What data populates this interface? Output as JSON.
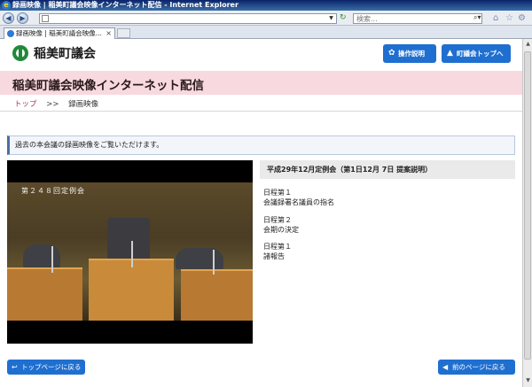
{
  "browser": {
    "window_title": "録画映像 | 稲美町議会映像インターネット配信 - Internet Explorer",
    "search_placeholder": "検索...",
    "tab_title": "録画映像 | 稲美町議会映像..."
  },
  "header": {
    "site_name": "稲美町議会",
    "guide_button": "操作説明",
    "council_top_button": "町議会トップへ"
  },
  "banner": {
    "title": "稲美町議会映像インターネット配信"
  },
  "breadcrumb": {
    "home": "トップ",
    "separator": ">>",
    "current": "録画映像"
  },
  "notice": "過去の本会議の録画映像をご覧いただけます。",
  "player": {
    "caption": "第２４８回定例会"
  },
  "meeting": {
    "title": "平成29年12月定例会（第1日12月 7日 提案説明）",
    "agenda": [
      {
        "number": "日程第１",
        "item": "会議録署名議員の指名"
      },
      {
        "number": "日程第２",
        "item": "会期の決定"
      },
      {
        "number": "日程第１",
        "item": "諸報告"
      }
    ]
  },
  "footer": {
    "top_page_button": "トップページに戻る",
    "prev_page_button": "前のページに戻る"
  },
  "colors": {
    "accent_blue": "#1f6fd0",
    "banner_pink": "#f7d9df",
    "logo_green": "#1f8a3a",
    "breadcrumb_link": "#b0306a"
  }
}
